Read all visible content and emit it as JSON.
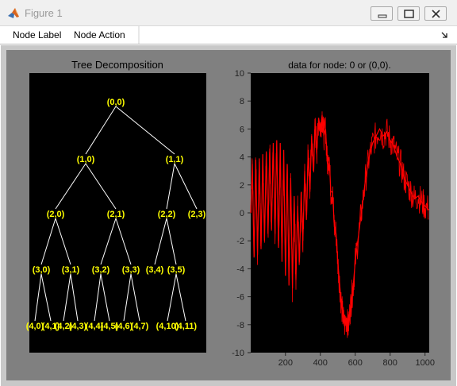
{
  "window": {
    "title": "Figure 1"
  },
  "menu": {
    "items": [
      "Node Label",
      "Node Action"
    ]
  },
  "tree_plot": {
    "title": "Tree Decomposition",
    "nodes": [
      {
        "label": "(0,0)"
      },
      {
        "label": "(1,0)"
      },
      {
        "label": "(1,1)"
      },
      {
        "label": "(2,0)"
      },
      {
        "label": "(2,1)"
      },
      {
        "label": "(2,2)"
      },
      {
        "label": "(2,3)"
      },
      {
        "label": "(3,0)"
      },
      {
        "label": "(3,1)"
      },
      {
        "label": "(3,2)"
      },
      {
        "label": "(3,3)"
      },
      {
        "label": "(3,4)"
      },
      {
        "label": "(3,5)"
      },
      {
        "label": "(4,0)"
      },
      {
        "label": "(4,1)"
      },
      {
        "label": "(4,2)"
      },
      {
        "label": "(4,3)"
      },
      {
        "label": "(4,4)"
      },
      {
        "label": "(4,5)"
      },
      {
        "label": "(4,6)"
      },
      {
        "label": "(4,7)"
      },
      {
        "label": "(4,10)"
      },
      {
        "label": "(4,11)"
      }
    ],
    "edges": [
      [
        0,
        1
      ],
      [
        0,
        2
      ],
      [
        1,
        3
      ],
      [
        1,
        4
      ],
      [
        2,
        5
      ],
      [
        2,
        6
      ],
      [
        3,
        7
      ],
      [
        3,
        8
      ],
      [
        4,
        9
      ],
      [
        4,
        10
      ],
      [
        5,
        11
      ],
      [
        5,
        12
      ],
      [
        7,
        13
      ],
      [
        7,
        14
      ],
      [
        8,
        15
      ],
      [
        8,
        16
      ],
      [
        9,
        17
      ],
      [
        9,
        18
      ],
      [
        10,
        19
      ],
      [
        10,
        20
      ],
      [
        12,
        21
      ],
      [
        12,
        22
      ]
    ],
    "colors": {
      "background": "#000000",
      "edge": "#ffffff",
      "label": "#ffff00"
    }
  },
  "chart_data": {
    "type": "line",
    "title": "data for node: 0 or (0,0).",
    "xlabel": "",
    "ylabel": "",
    "xlim": [
      1,
      1024
    ],
    "ylim": [
      -10,
      10
    ],
    "xticks": [
      200,
      400,
      600,
      800,
      1000
    ],
    "yticks": [
      -10,
      -8,
      -6,
      -4,
      -2,
      0,
      2,
      4,
      6,
      8,
      10
    ],
    "grid": false,
    "series": [
      {
        "color": "#ff0000",
        "x": [
          1,
          10,
          20,
          30,
          40,
          50,
          60,
          70,
          80,
          90,
          100,
          110,
          120,
          130,
          140,
          150,
          160,
          170,
          180,
          190,
          200,
          210,
          220,
          230,
          240,
          250,
          260,
          270,
          280,
          290,
          300,
          310,
          320,
          330,
          340,
          350,
          360,
          370,
          380,
          390,
          400,
          410,
          420,
          430,
          440,
          450,
          460,
          470,
          480,
          490,
          500,
          510,
          520,
          530,
          540,
          550,
          560,
          570,
          580,
          590,
          600,
          620,
          640,
          660,
          680,
          700,
          720,
          740,
          760,
          780,
          800,
          820,
          840,
          860,
          880,
          900,
          920,
          940,
          960,
          980,
          1000,
          1024
        ],
        "y": [
          0,
          3.5,
          -3.2,
          3.8,
          -3.0,
          3.9,
          -2.6,
          4.2,
          -2.0,
          4.4,
          -1.5,
          4.6,
          -1.2,
          5.0,
          -1.5,
          5.2,
          -2.5,
          5.0,
          -3.5,
          4.5,
          -4.5,
          3.5,
          -5.2,
          2.5,
          -5.4,
          1.2,
          -4.8,
          0.5,
          -3.5,
          1.5,
          -2.0,
          3.0,
          -0.5,
          4.5,
          1.5,
          5.5,
          3.0,
          6.2,
          4.5,
          6.8,
          6.0,
          7.0,
          5.5,
          6.0,
          3.5,
          4.0,
          1.5,
          1.5,
          -1.0,
          -1.5,
          -3.5,
          -5.0,
          -6.5,
          -7.5,
          -8.0,
          -7.5,
          -8.2,
          -7.0,
          -6.0,
          -5.0,
          -3.5,
          -1.5,
          0.5,
          2.5,
          4.0,
          5.0,
          5.5,
          6.0,
          5.5,
          5.8,
          5.2,
          4.8,
          4.0,
          3.5,
          2.5,
          2.0,
          1.5,
          1.0,
          1.2,
          0.8,
          0.5,
          0.2
        ]
      }
    ]
  }
}
